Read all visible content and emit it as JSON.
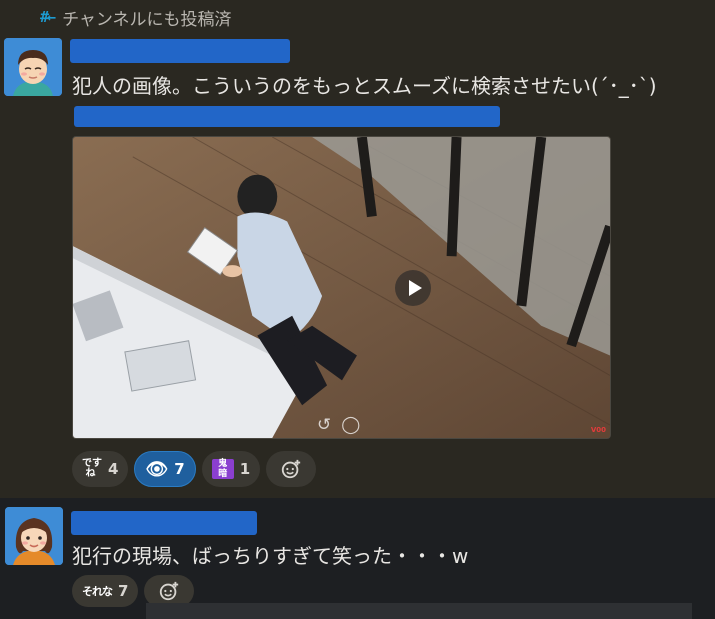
{
  "also_posted": {
    "icon": "hash-arrow-icon",
    "label": "チャンネルにも投稿済"
  },
  "messages": [
    {
      "text": "犯人の画像。こういうのをもっとスムーズに検索させたい(´･_･`)",
      "reactions": [
        {
          "emoji_label": "です\nね",
          "count": "4"
        },
        {
          "emoji_label": "👁",
          "count": "7"
        },
        {
          "emoji_label": "鬼\n暗",
          "count": "1"
        }
      ],
      "video": {
        "watermark": "V00"
      }
    },
    {
      "text": "犯行の現場、ばっちりすぎて笑った・・・w",
      "reactions": [
        {
          "emoji_label": "それな",
          "count": "7"
        }
      ]
    }
  ],
  "colors": {
    "redaction": "#2266c8",
    "active_reaction": "#1f5f9e"
  }
}
